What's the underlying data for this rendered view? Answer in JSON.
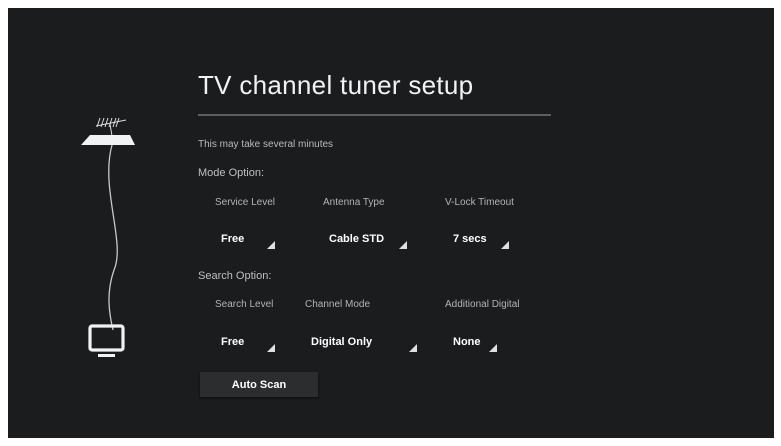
{
  "header": {
    "title": "TV channel tuner setup",
    "subtitle": "This may take several minutes"
  },
  "mode_option": {
    "label": "Mode Option:",
    "fields": [
      {
        "label": "Service Level",
        "value": "Free"
      },
      {
        "label": "Antenna Type",
        "value": "Cable STD"
      },
      {
        "label": "V-Lock Timeout",
        "value": "7 secs"
      }
    ]
  },
  "search_option": {
    "label": "Search Option:",
    "fields": [
      {
        "label": "Search Level",
        "value": "Free"
      },
      {
        "label": "Channel Mode",
        "value": "Digital Only"
      },
      {
        "label": "Additional Digital",
        "value": "None"
      }
    ]
  },
  "actions": {
    "auto_scan_label": "Auto Scan"
  },
  "icons": {
    "antenna": "antenna-icon",
    "cable": "cable-icon",
    "tv": "tv-icon",
    "caret": "dropdown-caret-icon"
  },
  "colors": {
    "background": "#1b1c1d",
    "text": "#ffffff",
    "divider": "#5c5e60",
    "button": "#2b2d2f"
  }
}
